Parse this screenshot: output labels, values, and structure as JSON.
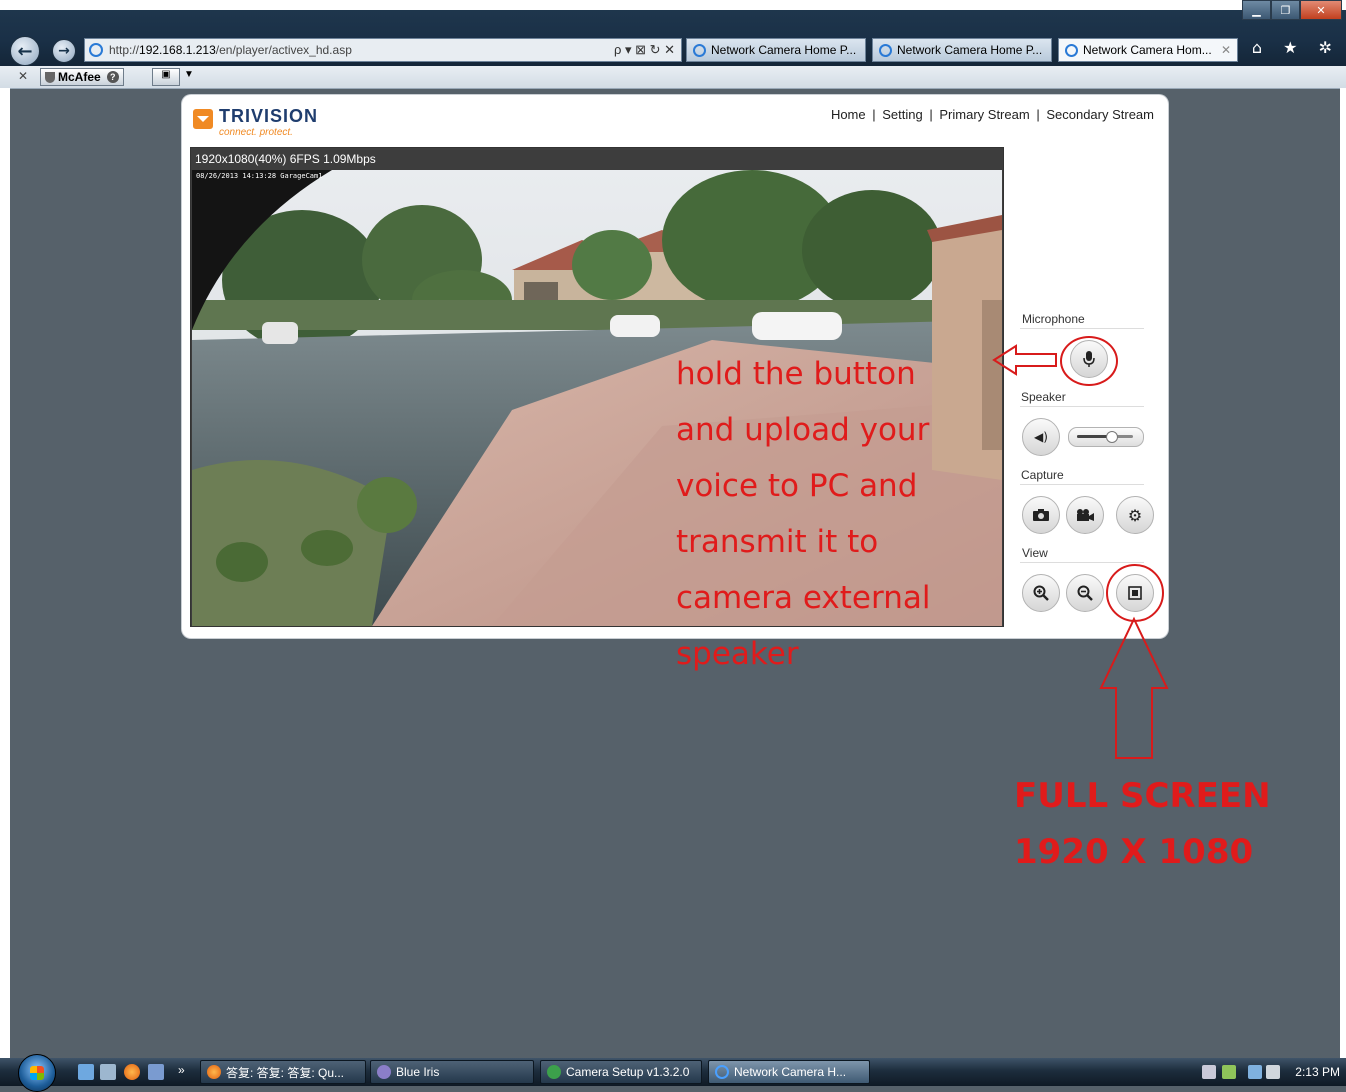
{
  "browser": {
    "url_prefix": "http://",
    "url_host": "192.168.1.213",
    "url_path": "/en/player/activex_hd.asp",
    "url_tools": "ρ ▾ ⊠ ↻ ✕",
    "tabs": [
      {
        "label": "Network Camera Home P..."
      },
      {
        "label": "Network Camera Home P..."
      },
      {
        "label": "Network Camera Hom..."
      }
    ],
    "toolbar_icons": "⌂ ★ ✲",
    "mcafee_label": "McAfee"
  },
  "player": {
    "brand": "TRIVISION",
    "tagline": "connect. protect.",
    "nav": [
      "Home",
      "Setting",
      "Primary Stream",
      "Secondary Stream"
    ],
    "nav_separator": "|",
    "stream_info": "1920x1080(40%) 6FPS 1.09Mbps",
    "timestamp": "08/26/2013 14:13:28 GarageCam1",
    "sections": {
      "microphone": "Microphone",
      "speaker": "Speaker",
      "capture": "Capture",
      "view": "View"
    },
    "speaker_volume": 0.6
  },
  "annotations": {
    "voice": "hold the button and upload your voice to PC and transmit it to camera external speaker",
    "fullscreen_line1": "FULL SCREEN",
    "fullscreen_line2": "1920 X 1080",
    "color": "#e01b1b"
  },
  "taskbar": {
    "overflow": "»",
    "items": [
      {
        "label": "答复: 答复: 答复: Qu..."
      },
      {
        "label": "Blue Iris"
      },
      {
        "label": "Camera Setup v1.3.2.0"
      },
      {
        "label": "Network Camera H..."
      }
    ],
    "clock": "2:13 PM"
  }
}
